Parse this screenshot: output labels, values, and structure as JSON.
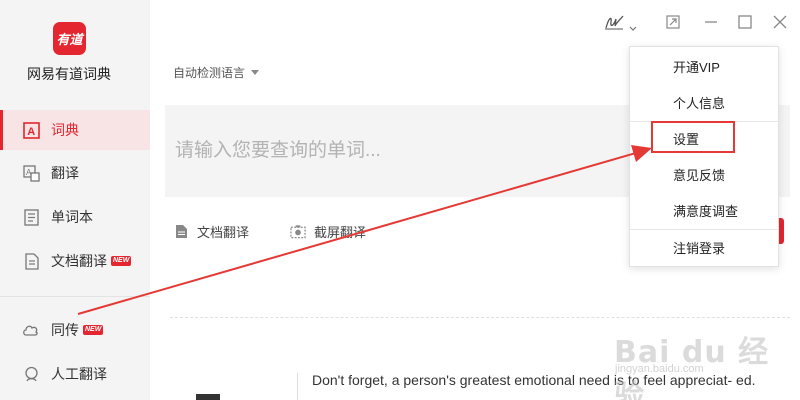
{
  "app": {
    "logo_text": "有道",
    "name": "网易有道词典"
  },
  "sidebar": {
    "items": [
      {
        "label": "词典",
        "icon": "dictionary-icon"
      },
      {
        "label": "翻译",
        "icon": "translate-icon"
      },
      {
        "label": "单词本",
        "icon": "wordbook-icon"
      },
      {
        "label": "文档翻译",
        "icon": "document-icon",
        "badge": "NEW"
      },
      {
        "label": "同传",
        "icon": "interpret-icon",
        "badge": "NEW"
      },
      {
        "label": "人工翻译",
        "icon": "human-translate-icon"
      }
    ]
  },
  "main": {
    "language_select": "自动检测语言",
    "search_placeholder": "请输入您要查询的单词...",
    "tools": [
      {
        "label": "文档翻译",
        "icon": "document-icon"
      },
      {
        "label": "截屏翻译",
        "icon": "camera-icon"
      }
    ],
    "daily_sentence": "Don't forget, a person's greatest emotional need is to feel appreciat- ed."
  },
  "menu": {
    "items": [
      {
        "label": "开通VIP"
      },
      {
        "label": "个人信息"
      },
      {
        "label": "设置"
      },
      {
        "label": "意见反馈"
      },
      {
        "label": "满意度调查"
      },
      {
        "label": "注销登录"
      }
    ]
  },
  "watermark": {
    "text": "Bai du 经验",
    "sub": "jingyan.baidu.com"
  },
  "colors": {
    "accent": "#e3262f",
    "annotation": "#e53935"
  }
}
